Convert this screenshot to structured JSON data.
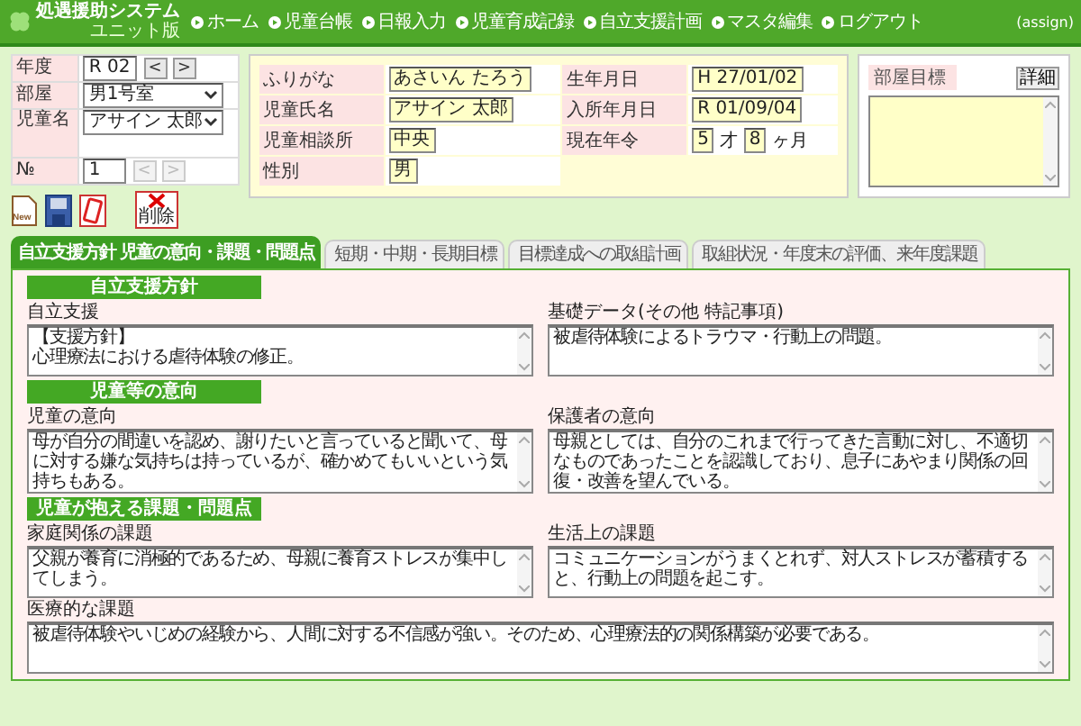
{
  "header": {
    "title": "処遇援助システム",
    "subtitle": "ユニット版",
    "menu": [
      "ホーム",
      "児童台帳",
      "日報入力",
      "児童育成記録",
      "自立支援計画",
      "マスタ編集",
      "ログアウト"
    ],
    "user": "(assign)"
  },
  "selector": {
    "year": {
      "label": "年度",
      "value": "R 02",
      "prev": "<",
      "next": ">",
      "disabled": false
    },
    "room": {
      "label": "部屋",
      "value": "男1号室"
    },
    "child": {
      "label": "児童名",
      "value": "アサイン 太郎"
    },
    "number": {
      "label": "№",
      "value": "1",
      "prev": "<",
      "next": ">",
      "disabled": true
    }
  },
  "toolbar": [
    {
      "kind": "new",
      "label": "New"
    },
    {
      "kind": "save"
    },
    {
      "kind": "print"
    },
    {
      "kind": "delete",
      "label": "削除"
    }
  ],
  "profile": [
    {
      "label": "ふりがな",
      "value": "あさいん たろう"
    },
    {
      "label": "生年月日",
      "value": "H 27/01/02"
    },
    {
      "label": "児童氏名",
      "value": "アサイン 太郎"
    },
    {
      "label": "入所年月日",
      "value": "R 01/09/04"
    },
    {
      "label": "児童相談所",
      "value": "中央"
    },
    {
      "label": "現在年令",
      "years": "5",
      "years_unit": "才",
      "months": "8",
      "months_unit": "ヶ月"
    },
    {
      "label": "性別",
      "value": "男"
    }
  ],
  "room_goal": {
    "label": "部屋目標",
    "button": "詳細"
  },
  "tabs": [
    {
      "label": "自立支援方針 児童の意向・課題・問題点",
      "selected": true
    },
    {
      "label": "短期・中期・長期目標",
      "selected": false
    },
    {
      "label": "目標達成への取組計画",
      "selected": false
    },
    {
      "label": "取組状況・年度末の評価、来年度課題",
      "selected": false
    }
  ],
  "sections": [
    {
      "title": "自立支援方針",
      "fields": [
        {
          "label": "自立支援",
          "lines": [
            "【支援方針】",
            "心理療法における虐待体験の修正。"
          ]
        },
        {
          "label": "基礎データ(その他 特記事項)",
          "value": "被虐待体験によるトラウマ・行動上の問題。"
        }
      ]
    },
    {
      "title": "児童等の意向",
      "fields": [
        {
          "label": "児童の意向",
          "value": "母が自分の間違いを認め、謝りたいと言っていると聞いて、母に対する嫌な気持ちは持っているが、確かめてもいいという気持ちもある。"
        },
        {
          "label": "保護者の意向",
          "value": "母親としては、自分のこれまで行ってきた言動に対し、不適切なものであったことを認識しており、息子にあやまり関係の回復・改善を望んでいる。"
        }
      ]
    },
    {
      "title": "児童が抱える課題・問題点",
      "fields": [
        {
          "label": "家庭関係の課題",
          "value": "父親が養育に消極的であるため、母親に養育ストレスが集中してしまう。"
        },
        {
          "label": "生活上の課題",
          "value": "コミュニケーションがうまくとれず、対人ストレスが蓄積すると、行動上の問題を起こす。"
        },
        {
          "label": "医療的な課題",
          "value": "被虐待体験やいじめの経験から、人間に対する不信感が強い。そのため、心理療法的の関係構築が必要である。",
          "wide": true
        }
      ]
    }
  ]
}
